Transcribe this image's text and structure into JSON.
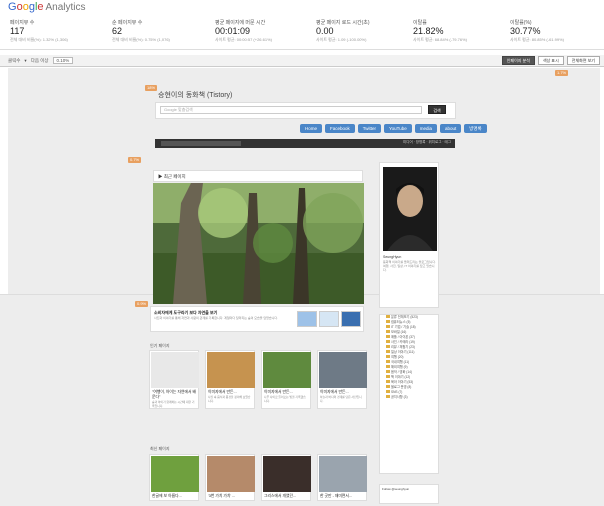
{
  "app": {
    "brand_google": "Google",
    "brand_analytics": "Analytics"
  },
  "metrics": [
    {
      "label": "페이지뷰 수",
      "value": "117",
      "sub": "전체 대비 비율(%): 1.32% (1,306)"
    },
    {
      "label": "순 페이지뷰 수",
      "value": "62",
      "sub": "전체 대비 비율(%): 0.75% (1,076)"
    },
    {
      "label": "평균 페이지에 머문 시간",
      "value": "00:01:09",
      "sub": "사이트 평균: 00:00:57 (+26.61%)"
    },
    {
      "label": "평균 페이지 로드 시간(초)",
      "value": "0.00",
      "sub": "사이트 평균: 1.09 (-100.00%)"
    },
    {
      "label": "이탈률",
      "value": "21.82%",
      "sub": "사이트 평균: 68.84% (-79.76%)"
    },
    {
      "label": "이탈률(%)",
      "value": "30.77%",
      "sub": "사이트 평균: 80.85% (-61.99%)"
    }
  ],
  "toolbar": {
    "metric_select": "클릭수",
    "threshold_label": "다음 이상",
    "threshold_value": "0.10%",
    "btn_show_stats": "인페이지 분석",
    "btn_color": "색상 표시",
    "btn_fullscreen": "전체화면 보기"
  },
  "badges": {
    "b_top_right": "1.7%",
    "b_nav": "18%",
    "b_left": "0.7%",
    "b_feature": "0.9%"
  },
  "blog": {
    "title": "승현이의 동화책 (Tistory)",
    "search_placeholder": "Google 맞춤검색",
    "search_button": "검색",
    "nav": [
      "Home",
      "Facebook",
      "Twitter",
      "YouTube",
      "media",
      "about",
      "방명록"
    ],
    "blackbar_right": "미디어 · 방명록 · 위치로그 · 태그",
    "recent_posts": "▶ 최근 페이지",
    "profile_name": "SeungHyun",
    "profile_text": "동화책 이야기를 들려드리는 블로그입니다. 여행, 사진, 일상, IT 이야기를 담고 있습니다.",
    "feature_title": "소비자에게 도구라기 보다 자연을 보기",
    "feature_desc": "사진과 이야기를 통해 자연과 사람의 관계를 기록합니다. 계절마다 달라지는 숲의 모습을 담았습니다.",
    "section_popular": "인기 페이지",
    "section_recent": "최신 페이지",
    "row1": [
      {
        "title": "\"여행이, 아이는 자연에서 배운다\"",
        "text": "숲과 아이가 함께하는 시간에 대한 기록입니다."
      },
      {
        "title": "이미지에서 만든...",
        "text": "사진 속 음식과 풍경을 정리해 보았습니다."
      },
      {
        "title": "이미지에서 만든...",
        "text": "나무 사이로 들어오는 빛을 기록했습니다."
      },
      {
        "title": "이미지에서 만든...",
        "text": "하늘과 바다의 경계를 담은 사진입니다."
      }
    ],
    "row2": [
      {
        "title": "한글에 보 아름다...",
        "text": "초록빛 잎사귀 사이의 작은 이야기."
      },
      {
        "title": "'3번 가치 가치' ...",
        "text": "인물과 시간에 대한 짧은 메모."
      },
      {
        "title": "그리스에서 개였던...",
        "text": "오래된 거리의 밤 풍경."
      },
      {
        "title": "한 곳만 - 재미면서...",
        "text": "해가 지는 바다를 바라보며."
      }
    ],
    "sidebar": [
      "분류 전체보기 (523)",
      "컴퓨터뉴스 (5)",
      "IT 기업 / 기술 (18)",
      "모바일 (16)",
      "애플 / 아이폰 (37)",
      "사진 / 카메라 (19)",
      "리뷰 / 체험기 (23)",
      "일상 이야기 (111)",
      "여행 (20)",
      "국내여행 (11)",
      "해외여행 (9)",
      "음악 / 영화 (14)",
      "책 이야기 (12)",
      "육아 이야기 (53)",
      "블로그 운영 (8)",
      "SNS (7)",
      "공지사항 (3)"
    ],
    "follow": "Follow @seunghyun"
  }
}
